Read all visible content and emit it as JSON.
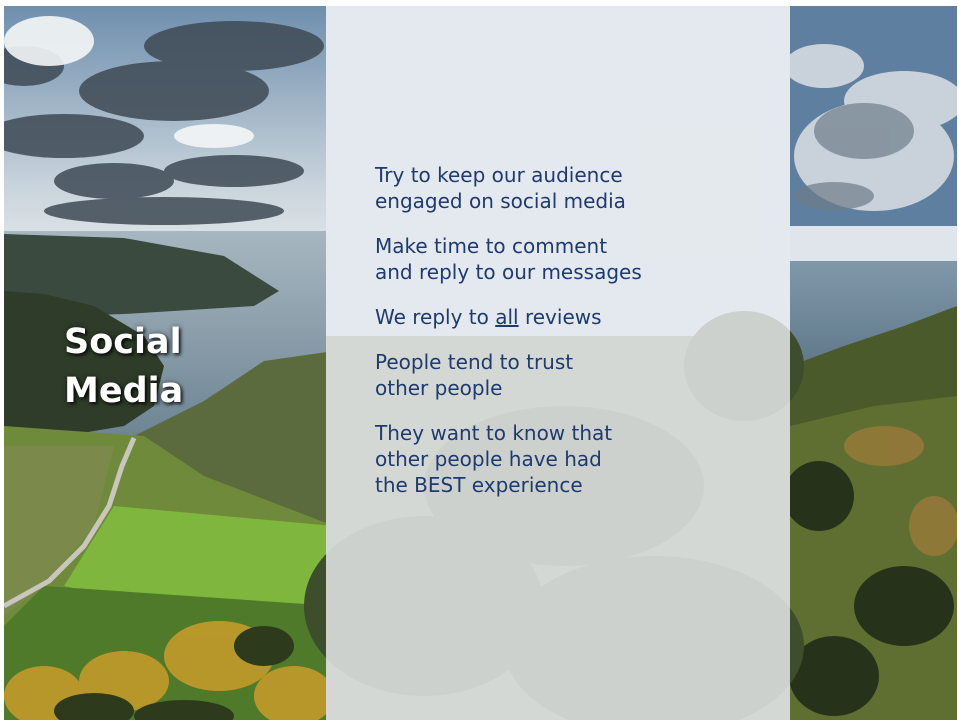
{
  "slide": {
    "title_line1": "Social",
    "title_line2": "Media",
    "bullets": [
      {
        "text": "Try to keep our audience\nengaged on social media"
      },
      {
        "text": "Make time to comment\nand reply to our messages"
      },
      {
        "before": "We reply to ",
        "emphasis": "all",
        "after": " reviews"
      },
      {
        "text": "People tend to trust\nother people"
      },
      {
        "text": "They want to know that\nother people have had\nthe BEST experience"
      }
    ]
  },
  "colors": {
    "title": "#ffffff",
    "body_text": "#1f3a6e",
    "panel": "#f1f3f7"
  },
  "background": {
    "description_icon": "coastal-landscape-photo"
  }
}
